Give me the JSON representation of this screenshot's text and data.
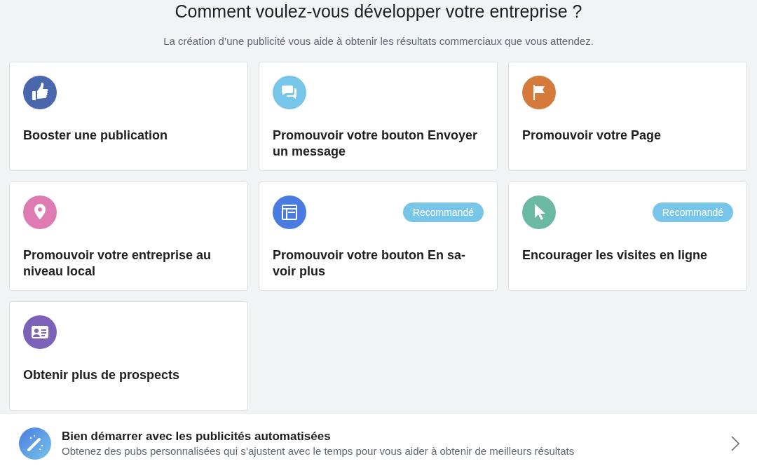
{
  "title": "Comment voulez-vous développer votre entreprise ?",
  "subtitle": "La création d’une publicité vous aide à obtenir les résultats commerciaux que vous attendez.",
  "cards": [
    {
      "kind": "thumb",
      "color": "#4a66ad",
      "label": "Booster une publication"
    },
    {
      "kind": "chat",
      "color": "#77c5e9",
      "label": "Promouvoir votre bouton Envoyer un message"
    },
    {
      "kind": "flag",
      "color": "#d47b3b",
      "label": "Promouvoir votre Page"
    },
    {
      "kind": "pin",
      "color": "#de7bb3",
      "label": "Promouvoir votre entreprise au niveau local"
    },
    {
      "kind": "window",
      "color": "#4a7be0",
      "label": "Promouvoir votre bouton En sa-voir plus",
      "badge": "Recommandé"
    },
    {
      "kind": "cursor",
      "color": "#6bb8a5",
      "label": "Encourager les visites en ligne",
      "badge": "Recommandé"
    },
    {
      "kind": "card",
      "color": "#7b61b8",
      "label": "Obtenir plus de prospects"
    }
  ],
  "footer": {
    "title": "Bien démarrer avec les publicités automatisées",
    "description": "Obtenez des pubs personnalisées qui s’ajustent avec le temps pour vous aider à obtenir de meilleurs résultats"
  }
}
